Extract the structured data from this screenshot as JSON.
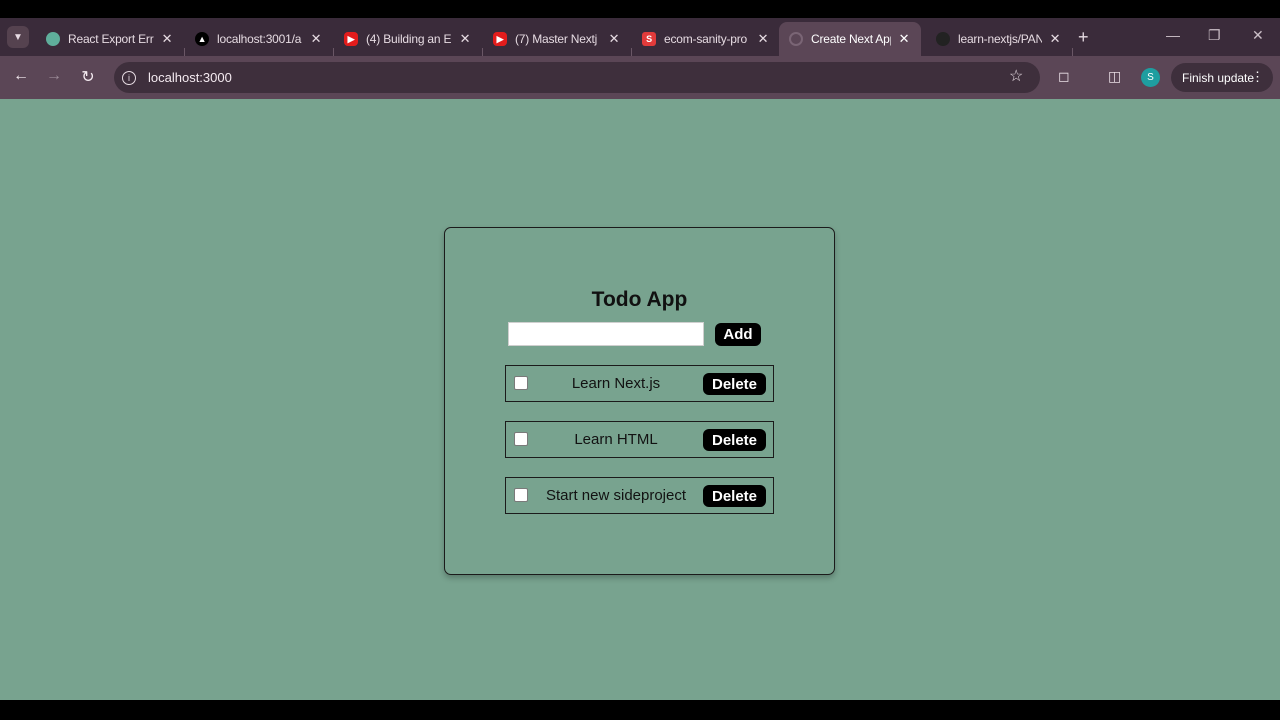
{
  "browser": {
    "tabs": [
      {
        "title": "React Export Erro",
        "favicon_color": "#5fae9b",
        "icon": "openai-icon"
      },
      {
        "title": "localhost:3001/a",
        "favicon_color": "#000000",
        "icon": "vercel-icon"
      },
      {
        "title": "(4) Building an E",
        "favicon_color": "#e21c1c",
        "icon": "youtube-icon"
      },
      {
        "title": "(7) Master Nextj",
        "favicon_color": "#e21c1c",
        "icon": "youtube-icon"
      },
      {
        "title": "ecom-sanity-pro",
        "favicon_color": "#e23b3b",
        "icon": "sanity-icon",
        "fav_letter": "S"
      },
      {
        "title": "Create Next App",
        "favicon_color": "#5b4656",
        "icon": "loading-icon",
        "active": true
      },
      {
        "title": "learn-nextjs/PAN",
        "favicon_color": "#222222",
        "icon": "github-icon"
      }
    ],
    "url": "localhost:3000",
    "finish_update_label": "Finish update",
    "profile_initial": "S"
  },
  "app": {
    "title": "Todo App",
    "input_value": "",
    "add_label": "Add",
    "todos": [
      {
        "text": "Learn Next.js",
        "done": false,
        "delete_label": "Delete"
      },
      {
        "text": "Learn HTML",
        "done": false,
        "delete_label": "Delete"
      },
      {
        "text": "Start new sideproject",
        "done": false,
        "delete_label": "Delete"
      }
    ]
  },
  "colors": {
    "page_background": "#78a38f",
    "browser_frame": "#3a2b3a",
    "toolbar": "#5b4656",
    "button": "#000000"
  }
}
